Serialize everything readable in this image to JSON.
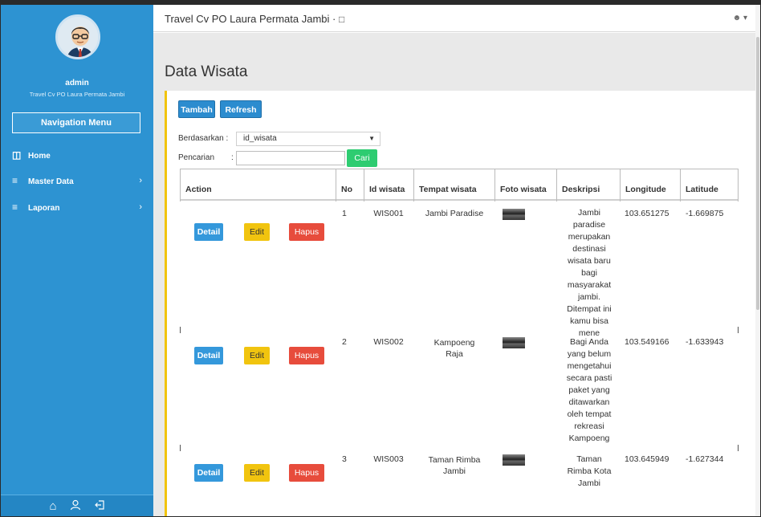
{
  "app": {
    "title": "Travel Cv PO Laura Permata Jambi ·",
    "monitor_icon": "monitor-icon"
  },
  "colors": {
    "sidebar": "#2d93d2",
    "accent_border": "#f1c40f",
    "primary": "#2c8ccf",
    "info": "#3498db",
    "warning": "#f1c40f",
    "danger": "#e74c3c",
    "success": "#2ecc71"
  },
  "sidebar": {
    "user_name": "admin",
    "user_company": "Travel Cv PO Laura Permata Jambi",
    "nav_menu_label": "Navigation Menu",
    "items": [
      {
        "label": "Home",
        "icon": "book-icon",
        "chevron": ""
      },
      {
        "label": "Master Data",
        "icon": "list-icon",
        "chevron": "›"
      },
      {
        "label": "Laporan",
        "icon": "list-icon",
        "chevron": "›"
      }
    ],
    "footer_icons": [
      "home-icon",
      "user-icon",
      "logout-icon"
    ]
  },
  "page": {
    "title": "Data Wisata",
    "buttons": {
      "add": "Tambah",
      "refresh": "Refresh"
    },
    "filter": {
      "by_label": "Berdasarkan :",
      "by_value": "id_wisata",
      "search_label": "Pencarian",
      "search_colon": ":",
      "search_value": "",
      "search_button": "Cari"
    }
  },
  "table": {
    "columns": [
      "Action",
      "No",
      "Id wisata",
      "Tempat wisata",
      "Foto wisata",
      "Deskripsi",
      "Longitude",
      "Latitude"
    ],
    "action_labels": {
      "detail": "Detail",
      "edit": "Edit",
      "delete": "Hapus"
    },
    "rows": [
      {
        "no": "1",
        "id": "WIS001",
        "place": "Jambi Paradise",
        "desc": "Jambi\nparadise\nmerupakan\ndestinasi\nwisata baru\nbagi\nmasyarakat\njambi.\nDitempat ini\nkamu bisa\nmene",
        "lng": "103.651275",
        "lat": "-1.669875"
      },
      {
        "no": "2",
        "id": "WIS002",
        "place": "Kampoeng\nRaja",
        "desc": "Bagi Anda\nyang belum\nmengetahui\nsecara pasti\npaket yang\nditawarkan\noleh tempat\nrekreasi\nKampoeng",
        "lng": "103.549166",
        "lat": "-1.633943"
      },
      {
        "no": "3",
        "id": "WIS003",
        "place": "Taman Rimba\nJambi",
        "desc": "Taman\nRimba Kota\nJambi",
        "lng": "103.645949",
        "lat": "-1.627344"
      }
    ]
  }
}
